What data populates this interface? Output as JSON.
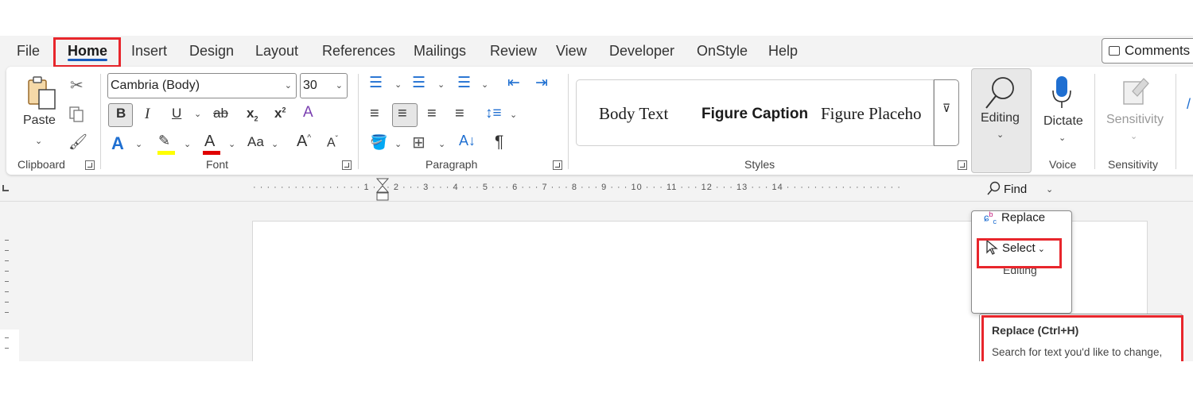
{
  "tabs": [
    {
      "label": "File"
    },
    {
      "label": "Home"
    },
    {
      "label": "Insert"
    },
    {
      "label": "Design"
    },
    {
      "label": "Layout"
    },
    {
      "label": "References"
    },
    {
      "label": "Mailings"
    },
    {
      "label": "Review"
    },
    {
      "label": "View"
    },
    {
      "label": "Developer"
    },
    {
      "label": "OnStyle"
    },
    {
      "label": "Help"
    }
  ],
  "comments_label": "Comments",
  "clipboard": {
    "paste_label": "Paste",
    "group_label": "Clipboard"
  },
  "font": {
    "name": "Cambria (Body)",
    "size": "30",
    "group_label": "Font",
    "bold": "B",
    "italic": "I",
    "underline": "U",
    "strike": "ab",
    "subscript": "x",
    "superscript": "x",
    "change_case": "Aa",
    "grow": "A",
    "shrink": "A"
  },
  "paragraph": {
    "group_label": "Paragraph"
  },
  "styles": {
    "items": [
      "Body Text",
      "Figure Caption",
      "Figure Placeho"
    ],
    "group_label": "Styles"
  },
  "editing": {
    "label": "Editing"
  },
  "voice": {
    "dictate_label": "Dictate",
    "group_label": "Voice"
  },
  "sensitivity": {
    "label": "Sensitivity",
    "group_label": "Sensitivity"
  },
  "ruler": {
    "text": "· · · · · · · · · · · · · · · · 1 · · · 2 · · · 3 · · · 4 · · · 5 · · · 6 · · · 7 · · · 8 · · · 9 · · · 10 · · · 11 · · · 12 · · · 13 · · · 14 · · · · · · · · · · · · · · · · ·"
  },
  "editing_menu": {
    "find": "Find",
    "replace": "Replace",
    "select": "Select",
    "footer": "Editing"
  },
  "tooltip": {
    "title": "Replace (Ctrl+H)",
    "body": "Search for text you'd like to change, and replace it with something else."
  },
  "colors": {
    "accent": "#185abd",
    "highlight_border": "#e8262c",
    "highlight_yellow": "#ffff00",
    "font_color_red": "#e00000"
  }
}
